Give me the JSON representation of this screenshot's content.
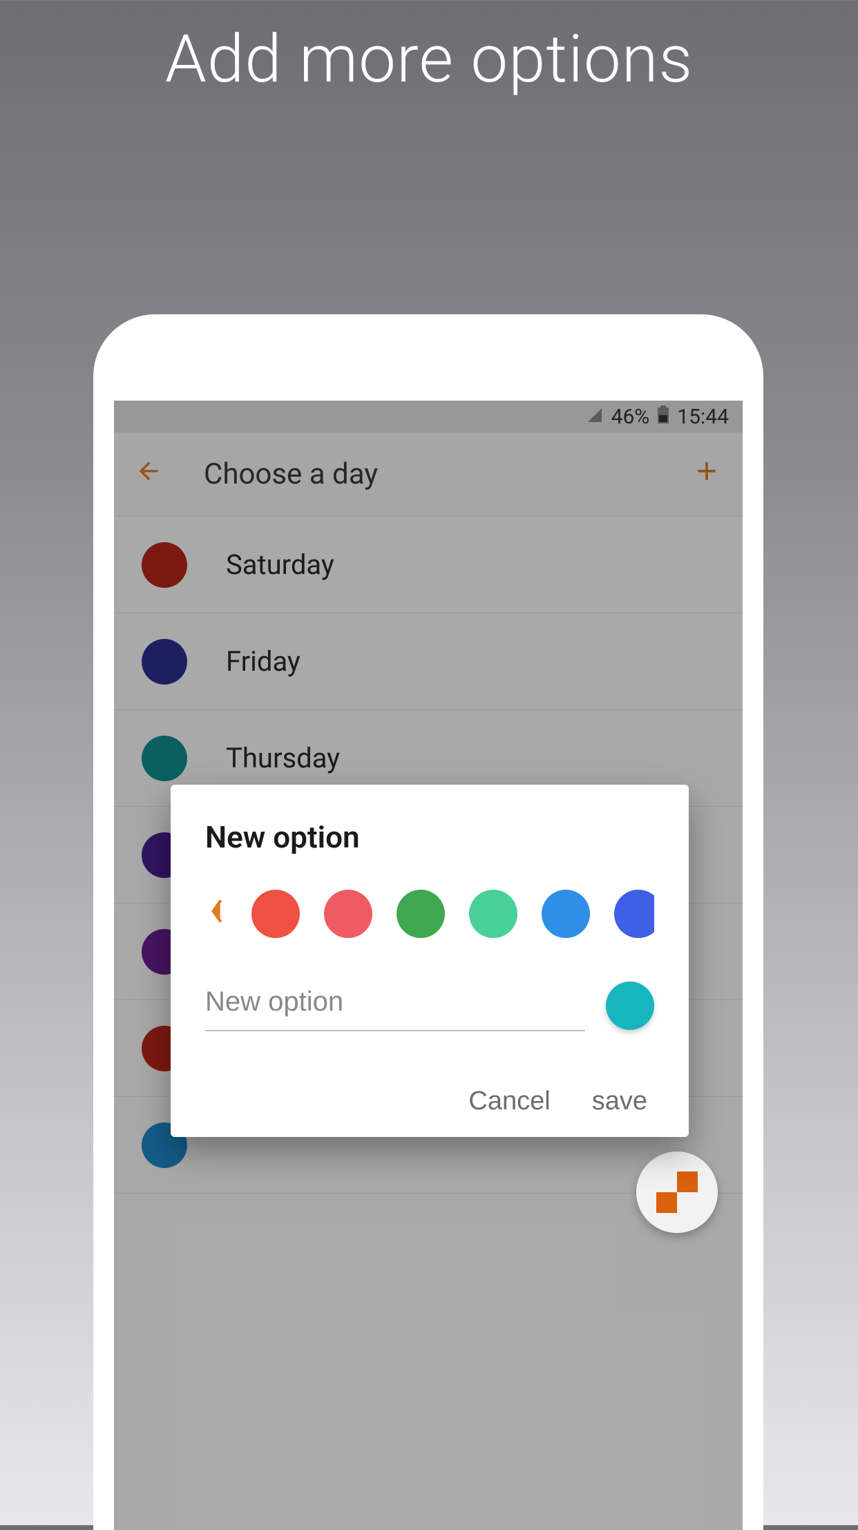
{
  "promo_title": "Add more options",
  "status": {
    "battery_pct": "46%",
    "time": "15:44"
  },
  "app_bar": {
    "title": "Choose a day"
  },
  "days": [
    {
      "label": "Saturday",
      "color": "#b7261a"
    },
    {
      "label": "Friday",
      "color": "#2d2f8f"
    },
    {
      "label": "Thursday",
      "color": "#0f8e8e"
    },
    {
      "label": "",
      "color": "#4b1e8f"
    },
    {
      "label": "",
      "color": "#6a1e8f"
    },
    {
      "label": "",
      "color": "#b7261a"
    },
    {
      "label": "",
      "color": "#1e88c9"
    }
  ],
  "dialog": {
    "title": "New option",
    "colors": [
      "#ef5042",
      "#ef5b62",
      "#3fa850",
      "#49cf98",
      "#2f8fe6",
      "#3f5fe6"
    ],
    "input_placeholder": "New option",
    "input_value": "",
    "selected_color": "#17b6be",
    "cancel_label": "Cancel",
    "save_label": "save"
  }
}
